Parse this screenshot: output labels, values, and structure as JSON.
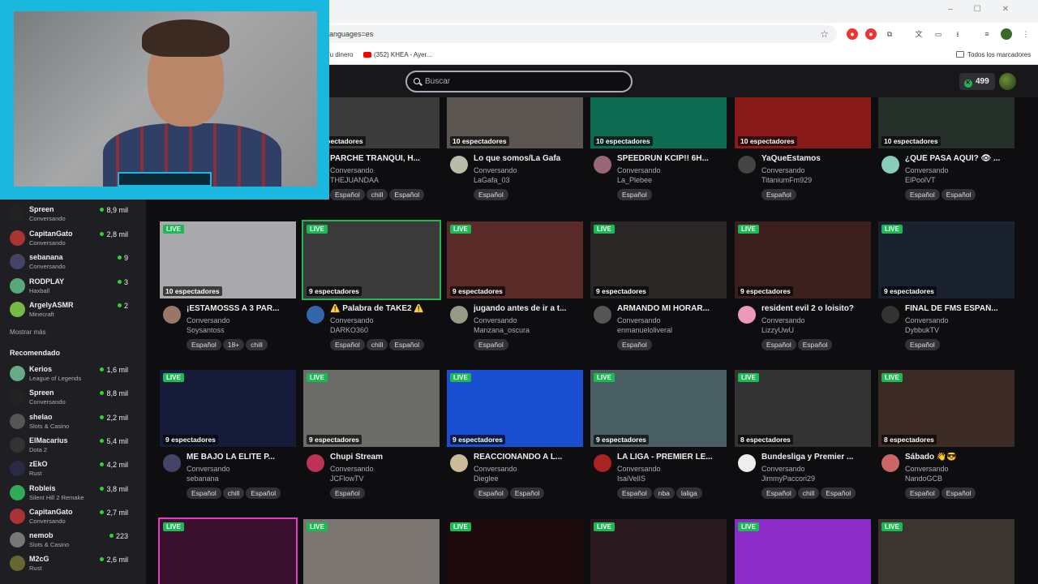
{
  "browser": {
    "address": "languages=es",
    "bookmarks": [
      {
        "label": "Tu dinero"
      },
      {
        "label": "(352) KHEA - Ayer..."
      }
    ],
    "all_bookmarks": "Todos los marcadores"
  },
  "header": {
    "search_placeholder": "Buscar",
    "bits": "499"
  },
  "sidebar": {
    "followed": [
      {
        "name": "Spreen",
        "game": "Conversando",
        "viewers": "8,9 mil",
        "color": "#222"
      },
      {
        "name": "CapitanGato",
        "game": "Conversando",
        "viewers": "2,8 mil",
        "color": "#a33"
      },
      {
        "name": "sebanana",
        "game": "Conversando",
        "viewers": "9",
        "color": "#446"
      },
      {
        "name": "RODPLAY",
        "game": "Haxball",
        "viewers": "3",
        "color": "#5a7"
      },
      {
        "name": "ArgelyASMR",
        "game": "Minecraft",
        "viewers": "2",
        "color": "#7b4"
      }
    ],
    "show_more": "Mostrar más",
    "recommended_heading": "Recomendado",
    "recommended": [
      {
        "name": "Kerios",
        "game": "League of Legends",
        "viewers": "1,6 mil",
        "color": "#6a8"
      },
      {
        "name": "Spreen",
        "game": "Conversando",
        "viewers": "8,8 mil",
        "color": "#222"
      },
      {
        "name": "shelao",
        "game": "Slots & Casino",
        "viewers": "2,2 mil",
        "color": "#555"
      },
      {
        "name": "ElMacarius",
        "game": "Dota 2",
        "viewers": "5,4 mil",
        "color": "#333"
      },
      {
        "name": "zEkO",
        "game": "Rust",
        "viewers": "4,2 mil",
        "color": "#2a2a44"
      },
      {
        "name": "Robleis",
        "game": "Silent Hill 2 Remake",
        "viewers": "3,8 mil",
        "color": "#3a5"
      },
      {
        "name": "CapitanGato",
        "game": "Conversando",
        "viewers": "2,7 mil",
        "color": "#a33"
      },
      {
        "name": "nemob",
        "game": "Slots & Casino",
        "viewers": "223",
        "color": "#777"
      },
      {
        "name": "M2cG",
        "game": "Rust",
        "viewers": "2,6 mil",
        "color": "#663"
      }
    ]
  },
  "live_label": "LIVE",
  "cards": [
    {
      "title": "PARCHE TRANQUI, H...",
      "category": "Conversando",
      "user": "THEJUANDAA",
      "viewers": "10 espectadores",
      "tags": [
        "Español",
        "chill",
        "Español"
      ],
      "thumb": "#3b3b3b",
      "av": "#885"
    },
    {
      "title": "Lo que somos/La Gafa",
      "category": "Conversando",
      "user": "LaGafa_03",
      "viewers": "10 espectadores",
      "tags": [
        "Español"
      ],
      "thumb": "#5a5550",
      "av": "#bba"
    },
    {
      "title": "SPEEDRUN KCIP!! 6H...",
      "category": "Conversando",
      "user": "La_Plebee",
      "viewers": "10 espectadores",
      "tags": [
        "Español"
      ],
      "thumb": "#0d6b52",
      "av": "#967"
    },
    {
      "title": "YaQueEstamos",
      "category": "Conversando",
      "user": "TitaniumFm929",
      "viewers": "10 espectadores",
      "tags": [
        "Español"
      ],
      "thumb": "#8a1a1a",
      "av": "#444"
    },
    {
      "title": "¿QUÉ PASA AQUÍ? 👁 ...",
      "category": "Conversando",
      "user": "ElPoolVT",
      "viewers": "10 espectadores",
      "tags": [
        "Español",
        "Español"
      ],
      "thumb": "#26302a",
      "av": "#8cb"
    },
    {
      "title": "¡ESTAMOSSS A 3 PAR...",
      "category": "Conversando",
      "user": "Soysantoss",
      "viewers": "10 espectadores",
      "tags": [
        "Español",
        "18+",
        "chill"
      ],
      "thumb": "#a9a9ad",
      "av": "#976"
    },
    {
      "title": "⚠️ Palabra de TAKE2 ⚠️",
      "category": "Conversando",
      "user": "DARKO360",
      "viewers": "9 espectadores",
      "tags": [
        "Español",
        "chill",
        "Español"
      ],
      "thumb": "#3a3a3a",
      "av": "#36a"
    },
    {
      "title": "jugando antes de ir a t...",
      "category": "Conversando",
      "user": "Manzana_oscura",
      "viewers": "9 espectadores",
      "tags": [
        "Español"
      ],
      "thumb": "#5a2a28",
      "av": "#998"
    },
    {
      "title": "ARMANDO MI HORAR...",
      "category": "Conversando",
      "user": "enmanueloliveral",
      "viewers": "9 espectadores",
      "tags": [
        "Español"
      ],
      "thumb": "#2a2625",
      "av": "#555"
    },
    {
      "title": "resident evil 2 o loisito?",
      "category": "Conversando",
      "user": "LizzyUwU",
      "viewers": "9 espectadores",
      "tags": [
        "Español",
        "Español"
      ],
      "thumb": "#3b1f1c",
      "av": "#e9b"
    },
    {
      "title": "FINAL DE FMS ESPAÑ...",
      "category": "Conversando",
      "user": "DybbukTV",
      "viewers": "9 espectadores",
      "tags": [
        "Español"
      ],
      "thumb": "#1a2230",
      "av": "#333"
    },
    {
      "title": "ME BAJO LA ÉLITE P...",
      "category": "Conversando",
      "user": "sebanana",
      "viewers": "9 espectadores",
      "tags": [
        "Español",
        "chill",
        "Español"
      ],
      "thumb": "#161b3a",
      "av": "#446"
    },
    {
      "title": "Chupi Stream",
      "category": "Conversando",
      "user": "JCFlowTV",
      "viewers": "9 espectadores",
      "tags": [
        "Español"
      ],
      "thumb": "#6b6b68",
      "av": "#b35"
    },
    {
      "title": "REACCIONANDO A L...",
      "category": "Conversando",
      "user": "Dieglee",
      "viewers": "9 espectadores",
      "tags": [
        "Español",
        "Español"
      ],
      "thumb": "#1b4fd1",
      "av": "#cb9"
    },
    {
      "title": "LA LIGA - PREMIER LE...",
      "category": "Conversando",
      "user": "IsaiVelIS",
      "viewers": "9 espectadores",
      "tags": [
        "Español",
        "nba",
        "laliga"
      ],
      "thumb": "#4a5f64",
      "av": "#a22"
    },
    {
      "title": "Bundesliga y Premier ...",
      "category": "Conversando",
      "user": "JimmyPaccori29",
      "viewers": "8 espectadores",
      "tags": [
        "Español",
        "chill",
        "Español"
      ],
      "thumb": "#333",
      "av": "#eee"
    },
    {
      "title": "Sábado 👋😎",
      "category": "Conversando",
      "user": "NandoGCB",
      "viewers": "8 espectadores",
      "tags": [
        "Español",
        "Español"
      ],
      "thumb": "#3b2b24",
      "av": "#c66"
    },
    {
      "title": "",
      "category": "",
      "user": "",
      "viewers": "",
      "tags": [],
      "thumb": "#3a1230",
      "av": "#000"
    },
    {
      "title": "",
      "category": "",
      "user": "",
      "viewers": "",
      "tags": [],
      "thumb": "#7a7570",
      "av": "#000"
    },
    {
      "title": "",
      "category": "",
      "user": "",
      "viewers": "",
      "tags": [],
      "thumb": "#1c0a0c",
      "av": "#000"
    },
    {
      "title": "",
      "category": "",
      "user": "",
      "viewers": "",
      "tags": [],
      "thumb": "#2a1a20",
      "av": "#000"
    },
    {
      "title": "",
      "category": "",
      "user": "",
      "viewers": "",
      "tags": [],
      "thumb": "#8b2cc7",
      "av": "#000"
    },
    {
      "title": "",
      "category": "",
      "user": "",
      "viewers": "",
      "tags": [],
      "thumb": "#3c342e",
      "av": "#000"
    }
  ]
}
